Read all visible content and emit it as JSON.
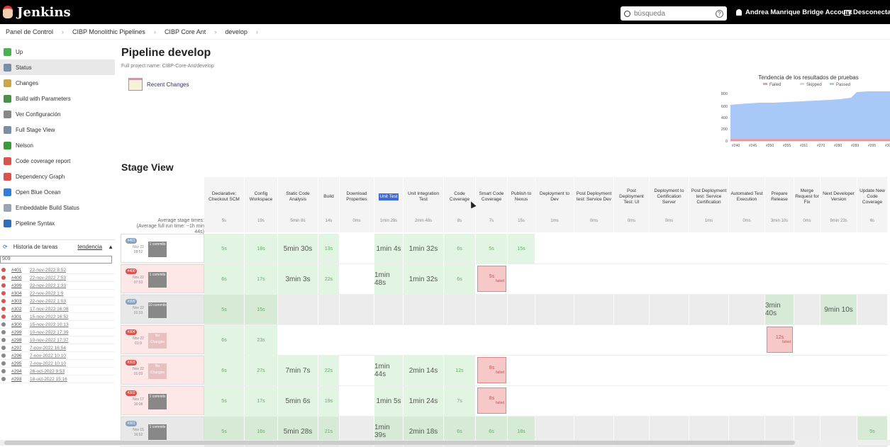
{
  "header": {
    "brand": "Jenkins",
    "search_placeholder": "búsqueda",
    "user": "Andrea Manrique Bridge Account",
    "logout": "Desconectar"
  },
  "breadcrumb": [
    "Panel de Control",
    "CIBP Monolithic Pipelines",
    "CIBP Core Ant",
    "develop"
  ],
  "sidebar": {
    "items": [
      {
        "label": "Up",
        "icon": "up-arrow-icon",
        "color": "#4caf50"
      },
      {
        "label": "Status",
        "icon": "search-icon",
        "color": "#7a8ea6",
        "active": true
      },
      {
        "label": "Changes",
        "icon": "notepad-icon",
        "color": "#c9a64a"
      },
      {
        "label": "Build with Parameters",
        "icon": "clock-icon",
        "color": "#4a8f4a"
      },
      {
        "label": "Ver Configuración",
        "icon": "gear-icon",
        "color": "#888888"
      },
      {
        "label": "Full Stage View",
        "icon": "search-icon",
        "color": "#7a8ea6"
      },
      {
        "label": "Nelson",
        "icon": "terminal-icon",
        "color": "#3c9a3c"
      },
      {
        "label": "Code coverage report",
        "icon": "report-icon",
        "color": "#d9534f"
      },
      {
        "label": "Dependency Graph",
        "icon": "graph-icon",
        "color": "#d9534f"
      },
      {
        "label": "Open Blue Ocean",
        "icon": "blue-ocean-icon",
        "color": "#2f7fd8"
      },
      {
        "label": "Embeddable Build Status",
        "icon": "shield-icon",
        "color": "#9aa5b1"
      },
      {
        "label": "Pipeline Syntax",
        "icon": "help-icon",
        "color": "#2f6fb5"
      }
    ]
  },
  "history": {
    "title": "Historia de tareas",
    "trend": "tendencia",
    "filter": "909",
    "rows": [
      {
        "num": "#401",
        "date": "22-nov-2022 8:52",
        "color": "#d9534f"
      },
      {
        "num": "#400",
        "date": "22-nov-2022 7:53",
        "color": "#d9534f"
      },
      {
        "num": "#399",
        "date": "22-nov-2022 1:33",
        "color": "#d9534f"
      },
      {
        "num": "#304",
        "date": "22-nov-2022 1:9",
        "color": "#d9534f"
      },
      {
        "num": "#303",
        "date": "22-nov-2022 1:03",
        "color": "#d9534f"
      },
      {
        "num": "#302",
        "date": "17-nov-2022 16:08",
        "color": "#d9534f"
      },
      {
        "num": "#301",
        "date": "15-nov-2022 16:52",
        "color": "#d9534f"
      },
      {
        "num": "#300",
        "date": "15-nov-2022 10:13",
        "color": "#888888"
      },
      {
        "num": "#299",
        "date": "10-nov-2022 17:39",
        "color": "#888888"
      },
      {
        "num": "#298",
        "date": "10-nov-2022 17:37",
        "color": "#888888"
      },
      {
        "num": "#297",
        "date": "7-nov-2022 16:54",
        "color": "#888888"
      },
      {
        "num": "#296",
        "date": "7-nov-2022 10:10",
        "color": "#888888"
      },
      {
        "num": "#295",
        "date": "7-nov-2022 10:10",
        "color": "#888888"
      },
      {
        "num": "#294",
        "date": "28-oct-2022 9:53",
        "color": "#888888"
      },
      {
        "num": "#293",
        "date": "18-oct-2022 15:16",
        "color": "#888888"
      }
    ]
  },
  "main": {
    "title": "Pipeline develop",
    "subtitle": "Full project name: CIBP-Core-Ant/develop",
    "recent_changes": "Recent Changes"
  },
  "trend_chart": {
    "title": "Tendencia de los resultados de pruebas",
    "legend": [
      "Failed",
      "Skipped",
      "Passed"
    ],
    "colors": {
      "failed": "#e8a0a8",
      "skipped": "#d0d8e0",
      "passed": "#a8c8f8"
    },
    "y_ticks": [
      "800",
      "600",
      "400",
      "200",
      "0"
    ],
    "x_ticks": [
      "#240",
      "#245",
      "#250",
      "#255",
      "#261",
      "#270",
      "#280",
      "#289",
      "#295",
      "#301"
    ]
  },
  "stage_view": {
    "title": "Stage View",
    "avg_label": "Average stage times:",
    "avg_label2": "(Average full run time: ~1h min",
    "avg_label3": "44s)",
    "stages": [
      {
        "name": "Declarative: Checkout SCM",
        "avg": "5s"
      },
      {
        "name": "Config Workspace",
        "avg": "19s"
      },
      {
        "name": "Static Code Analysis",
        "avg": "5min 8s"
      },
      {
        "name": "Build",
        "avg": "14s"
      },
      {
        "name": "Download Properties",
        "avg": "0ms"
      },
      {
        "name": "Unit Test",
        "avg": "1min 29s",
        "highlight": true
      },
      {
        "name": "Unit Integration Test",
        "avg": "2min 48s"
      },
      {
        "name": "Code Coverage",
        "avg": "8s"
      },
      {
        "name": "Smart Code Coverage",
        "avg": "7s"
      },
      {
        "name": "Publish to Nexus",
        "avg": "15s"
      },
      {
        "name": "Deployment to Dev",
        "avg": "1ms"
      },
      {
        "name": "Post Deployment test: Service Dev",
        "avg": "0ms"
      },
      {
        "name": "Post Deployment Test: UI",
        "avg": "0ms"
      },
      {
        "name": "Deployment to Certification Server",
        "avg": "0ms"
      },
      {
        "name": "Post Deployment test: Service Certification",
        "avg": "1ms"
      },
      {
        "name": "Automated Test Execution",
        "avg": "0ms"
      },
      {
        "name": "Prepare Release",
        "avg": "3min 10s"
      },
      {
        "name": "Merge Request for Fix",
        "avg": "0ms"
      },
      {
        "name": "Next Developer Version",
        "avg": "9min 23s"
      },
      {
        "name": "Update New Code Coverage",
        "avg": "6s"
      }
    ],
    "builds": [
      {
        "badge": "#401",
        "badge_color": "#8aa0bf",
        "date": "Nov 22 08:52",
        "changes": "1 commits",
        "row_bg": "#ffffff",
        "cells": [
          "5s",
          "18s",
          "5min 30s",
          "13s",
          "",
          "1min 4s",
          "1min 32s",
          "6s",
          "5s",
          "15s",
          "",
          "",
          "",
          "",
          "",
          "",
          "",
          "",
          "",
          ""
        ],
        "fails": []
      },
      {
        "badge": "#400",
        "badge_color": "#d9534f",
        "date": "Nov 22 07:53",
        "changes": "1 commits",
        "row_bg": "#fde7e7",
        "cells": [
          "6s",
          "17s",
          "3min 3s",
          "22s",
          "",
          "1min 48s",
          "1min 32s",
          "6s",
          "5s",
          "",
          "",
          "",
          "",
          "",
          "",
          "",
          "",
          "",
          "",
          ""
        ],
        "fails": [
          8
        ]
      },
      {
        "badge": "#399",
        "badge_color": "#8aa0bf",
        "date": "Nov 22 01:33",
        "changes": "10 commits",
        "row_bg": "#e8e8e8",
        "cells": [
          "5s",
          "15s",
          "",
          "",
          "",
          "",
          "",
          "",
          "",
          "",
          "",
          "",
          "",
          "",
          "",
          "",
          "3min 40s",
          "",
          "9min 10s",
          ""
        ],
        "fails": []
      },
      {
        "badge": "#304",
        "badge_color": "#d9534f",
        "date": "Nov 22 01:9",
        "changes": "No Changes",
        "row_bg": "#fde7e7",
        "cells": [
          "6s",
          "23s",
          "",
          "",
          "",
          "",
          "",
          "",
          "",
          "",
          "",
          "",
          "",
          "",
          "",
          "",
          "12s",
          "",
          "",
          ""
        ],
        "fails": [
          16
        ]
      },
      {
        "badge": "#303",
        "badge_color": "#d9534f",
        "date": "Nov 22 01:03",
        "changes": "No Changes",
        "row_bg": "#fde7e7",
        "cells": [
          "6s",
          "27s",
          "7min 7s",
          "22s",
          "",
          "1min 44s",
          "2min 14s",
          "12s",
          "8s",
          "",
          "",
          "",
          "",
          "",
          "",
          "",
          "",
          "",
          "",
          ""
        ],
        "fails": [
          8
        ]
      },
      {
        "badge": "#302",
        "badge_color": "#d9534f",
        "date": "Nov 17 16:08",
        "changes": "1 commits",
        "row_bg": "#fde7e7",
        "cells": [
          "5s",
          "17s",
          "5min 6s",
          "19s",
          "",
          "1min 5s",
          "1min 24s",
          "7s",
          "8s",
          "",
          "",
          "",
          "",
          "",
          "",
          "",
          "",
          "",
          "",
          ""
        ],
        "fails": [
          8
        ]
      },
      {
        "badge": "#301",
        "badge_color": "#8aa0bf",
        "date": "Nov 15 16:52",
        "changes": "1 commits",
        "row_bg": "#e8e8e8",
        "cells": [
          "5s",
          "16s",
          "5min 28s",
          "21s",
          "",
          "1min 39s",
          "2min 18s",
          "6s",
          "6s",
          "18s",
          "",
          "",
          "",
          "",
          "",
          "",
          "",
          "",
          "",
          "5s"
        ],
        "fails": []
      }
    ],
    "failed_label": "failed"
  }
}
